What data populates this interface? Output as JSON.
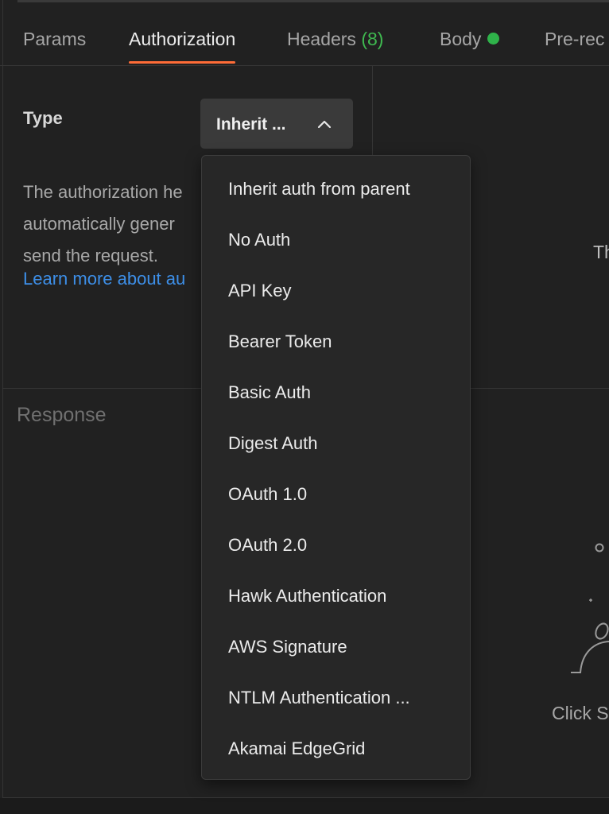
{
  "tabs": [
    {
      "label": "Params"
    },
    {
      "label": "Authorization"
    },
    {
      "label": "Headers",
      "count": "(8)"
    },
    {
      "label": "Body"
    },
    {
      "label": "Pre-rec"
    }
  ],
  "auth": {
    "type_label": "Type",
    "selected_value": "Inherit ...",
    "description": "The authorization he\nautomatically gener\nsend the request.",
    "learn_more": "Learn more about au"
  },
  "right_panel": {
    "truncated_text": "Th"
  },
  "response": {
    "title": "Response",
    "hint_text": "Click S"
  },
  "dropdown": {
    "options": [
      "Inherit auth from parent",
      "No Auth",
      "API Key",
      "Bearer Token",
      "Basic Auth",
      "Digest Auth",
      "OAuth 1.0",
      "OAuth 2.0",
      "Hawk Authentication",
      "AWS Signature",
      "NTLM Authentication ...",
      "Akamai EdgeGrid"
    ]
  },
  "colors": {
    "accent": "#ff6c37",
    "link": "#3d8fe8",
    "success": "#2fb34a",
    "background": "#212121",
    "menu": "#272727"
  },
  "icons": {
    "select": "chevron-up-icon",
    "body_status": "status-dot-icon"
  }
}
